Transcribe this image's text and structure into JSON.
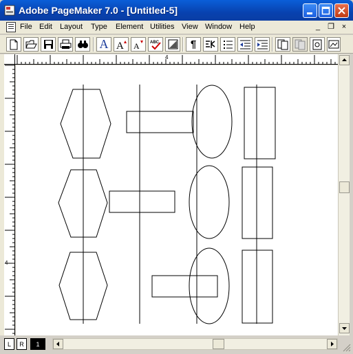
{
  "window": {
    "title": "Adobe PageMaker 7.0 - [Untitled-5]",
    "minimize_label": "_",
    "maximize_label": "□",
    "close_label": "✕"
  },
  "menubar": {
    "items": [
      {
        "label": "File"
      },
      {
        "label": "Edit"
      },
      {
        "label": "Layout"
      },
      {
        "label": "Type"
      },
      {
        "label": "Element"
      },
      {
        "label": "Utilities"
      },
      {
        "label": "View"
      },
      {
        "label": "Window"
      },
      {
        "label": "Help"
      }
    ],
    "doc_minimize": "_",
    "doc_restore": "❐",
    "doc_close": "×"
  },
  "toolbar": {
    "icons": [
      "new-icon",
      "open-icon",
      "save-icon",
      "print-icon",
      "find-icon",
      "text-icon",
      "font-size-up-icon",
      "font-size-down-icon",
      "spelling-icon",
      "fill-icon",
      "paragraph-icon",
      "indent-icon",
      "bullets-icon",
      "decrease-indent-icon",
      "increase-indent-icon",
      "master-page-icon",
      "copy-page-icon",
      "place-icon",
      "image-frame-icon"
    ],
    "text_tool": "A",
    "paragraph_tool": "¶",
    "spell_tool": "ABC"
  },
  "rulers": {
    "h_label": "4",
    "v_label": "4"
  },
  "pages": {
    "left_label": "L",
    "right_label": "R",
    "current_label": "1"
  },
  "colors": {
    "titlebar": "#0a5fd8",
    "canvas": "#ffffff",
    "chrome": "#ece9d8"
  }
}
